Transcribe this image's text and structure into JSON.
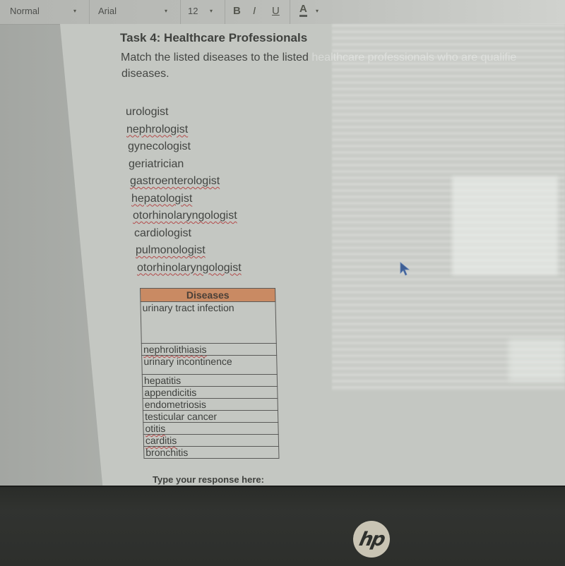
{
  "toolbar": {
    "style_select": "Normal",
    "font_select": "Arial",
    "size_select": "12",
    "bold_label": "B",
    "italic_label": "I",
    "underline_label": "U",
    "text_color_label": "A",
    "caret": "▾"
  },
  "document": {
    "title": "Task 4: Healthcare Professionals",
    "instruction_visible": "Match the listed diseases to the listed ",
    "instruction_faded": "healthcare professionals who are qualifie",
    "instruction_line2": "diseases.",
    "professionals": [
      {
        "name": "urologist",
        "flagged": false
      },
      {
        "name": "nephrologist",
        "flagged": true
      },
      {
        "name": "gynecologist",
        "flagged": false
      },
      {
        "name": "geriatrician",
        "flagged": false
      },
      {
        "name": "gastroenterologist",
        "flagged": true
      },
      {
        "name": "hepatologist",
        "flagged": true
      },
      {
        "name": "otorhinolaryngologist",
        "flagged": true
      },
      {
        "name": "cardiologist",
        "flagged": false
      },
      {
        "name": "pulmonologist",
        "flagged": true
      },
      {
        "name": "otorhinolaryngologist",
        "flagged": true
      }
    ],
    "table": {
      "header": "Diseases",
      "rows": [
        "urinary tract infection",
        "nephrolithiasis",
        "urinary incontinence",
        "hepatitis",
        "appendicitis",
        "endometriosis",
        "testicular cancer",
        "otitis",
        "carditis",
        "bronchitis"
      ]
    },
    "response_label": "Type your response here:"
  },
  "device": {
    "logo_text": "hp"
  }
}
